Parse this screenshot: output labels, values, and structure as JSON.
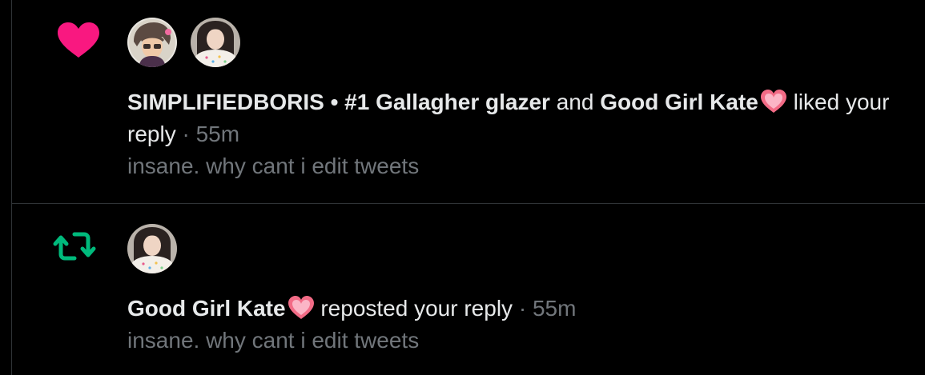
{
  "colors": {
    "background": "#000000",
    "divider": "#2f3336",
    "text_primary": "#e7e9ea",
    "text_secondary": "#71767b",
    "like_pink": "#f91880",
    "repost_green": "#00ba7c"
  },
  "notifications": [
    {
      "type_icon": "heart-icon",
      "avatars": [
        "avatar-simplifiedboris",
        "avatar-good-girl-kate"
      ],
      "user1": "SIMPLIFIEDBORIS • #1 Gallagher glazer",
      "connector": " and ",
      "user2": "Good Girl Kate",
      "user2_emoji": "heart-emoji-icon",
      "action": " liked your",
      "action_cont": "reply",
      "separator": " · ",
      "time": "55m",
      "tweet_text": "insane. why cant i edit tweets"
    },
    {
      "type_icon": "repost-icon",
      "avatars": [
        "avatar-good-girl-kate"
      ],
      "user1": "Good Girl Kate",
      "user1_emoji": "heart-emoji-icon",
      "action": " reposted your reply",
      "separator": " · ",
      "time": "55m",
      "tweet_text": "insane. why cant i edit tweets"
    }
  ]
}
